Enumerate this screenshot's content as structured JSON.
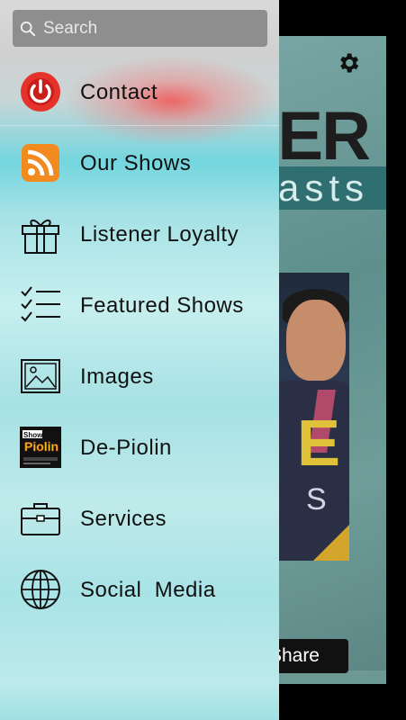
{
  "search": {
    "placeholder": "Search",
    "value": ""
  },
  "menu": [
    {
      "label": "Contact",
      "icon": "power-icon"
    },
    {
      "label": "Our Shows",
      "icon": "rss-icon"
    },
    {
      "label": "Listener Loyalty",
      "icon": "gift-icon"
    },
    {
      "label": "Featured Shows",
      "icon": "checklist-icon"
    },
    {
      "label": "Images",
      "icon": "image-icon"
    },
    {
      "label": "De-Piolin",
      "icon": "piolin-logo-icon"
    },
    {
      "label": "Services",
      "icon": "briefcase-icon"
    },
    {
      "label": "Social  Media",
      "icon": "globe-icon"
    }
  ],
  "background": {
    "title_fragment": "ER",
    "subtitle_fragment": "asts",
    "photo_letter": "E",
    "photo_small_letter": "S",
    "share_label": "Share"
  },
  "colors": {
    "power_red": "#e5322b",
    "rss_orange": "#f28b1f",
    "search_bg": "#8e8e8e",
    "panel_teal": "#2f6f72",
    "accent_gold": "#d4a52a"
  }
}
